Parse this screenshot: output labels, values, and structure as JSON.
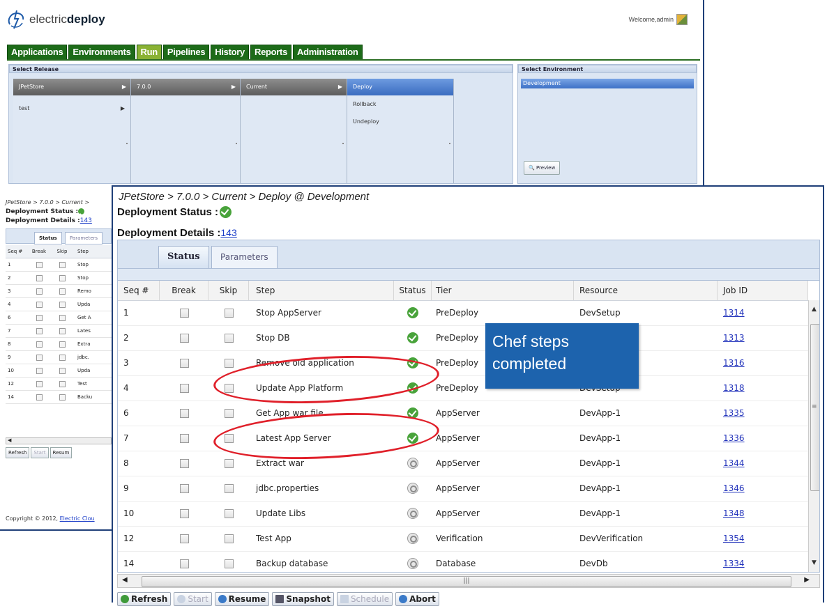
{
  "app": {
    "logo_plain": "electric",
    "logo_bold": "deploy",
    "welcome": "Welcome,admin"
  },
  "nav": {
    "tabs": [
      "Applications",
      "Environments",
      "Run",
      "Pipelines",
      "History",
      "Reports",
      "Administration"
    ],
    "active": "Run"
  },
  "release_panel": {
    "title": "Select Release",
    "applications": {
      "header": "JPetStore",
      "items": [
        "test"
      ]
    },
    "versions": {
      "header": "7.0.0"
    },
    "snapshots": {
      "header": "Current"
    },
    "processes": {
      "selected": "Deploy",
      "items": [
        "Rollback",
        "Undeploy"
      ]
    }
  },
  "env_panel": {
    "title": "Select Environment",
    "selected": "Development",
    "preview_label": "Preview"
  },
  "background_status": {
    "breadcrumb": "JPetStore > 7.0.0 > Current >",
    "status_label": "Deployment Status :",
    "details_label": "Deployment Details :",
    "details_link": "143",
    "tabs": [
      "Status",
      "Parameters"
    ],
    "columns": [
      "Seq #",
      "Break",
      "Skip",
      "Step"
    ],
    "rows": [
      {
        "seq": "1",
        "step": "Stop"
      },
      {
        "seq": "2",
        "step": "Stop"
      },
      {
        "seq": "3",
        "step": "Remo"
      },
      {
        "seq": "4",
        "step": "Upda"
      },
      {
        "seq": "6",
        "step": "Get A"
      },
      {
        "seq": "7",
        "step": "Lates"
      },
      {
        "seq": "8",
        "step": "Extra"
      },
      {
        "seq": "9",
        "step": "jdbc."
      },
      {
        "seq": "10",
        "step": "Upda"
      },
      {
        "seq": "12",
        "step": "Test"
      },
      {
        "seq": "14",
        "step": "Backu"
      }
    ],
    "toolbar": [
      "Refresh",
      "Start",
      "Resum"
    ],
    "copyright": "Copyright © 2012,",
    "copyright_link": "Electric Clou"
  },
  "deployment": {
    "breadcrumb": "JPetStore > 7.0.0 > Current > Deploy @ Development",
    "status_label": "Deployment Status :",
    "details_label": "Deployment Details :",
    "details_link": "143",
    "tabs": {
      "status": "Status",
      "parameters": "Parameters"
    },
    "columns": {
      "seq": "Seq #",
      "brk": "Break",
      "skip": "Skip",
      "step": "Step",
      "status": "Status",
      "tier": "Tier",
      "resource": "Resource",
      "job": "Job ID"
    },
    "rows": [
      {
        "seq": "1",
        "step": "Stop AppServer",
        "status": "completed",
        "tier": "PreDeploy",
        "resource": "DevSetup",
        "job": "1314"
      },
      {
        "seq": "2",
        "step": "Stop DB",
        "status": "completed",
        "tier": "PreDeploy",
        "resource": "",
        "job": "1313"
      },
      {
        "seq": "3",
        "step": "Remove old application",
        "status": "completed",
        "tier": "PreDeploy",
        "resource": "",
        "job": "1316"
      },
      {
        "seq": "4",
        "step": "Update App Platform",
        "status": "completed",
        "tier": "PreDeploy",
        "resource": "DevSetup",
        "job": "1318"
      },
      {
        "seq": "6",
        "step": "Get App war file",
        "status": "completed",
        "tier": "AppServer",
        "resource": "DevApp-1",
        "job": "1335"
      },
      {
        "seq": "7",
        "step": "Latest App Server",
        "status": "completed",
        "tier": "AppServer",
        "resource": "DevApp-1",
        "job": "1336"
      },
      {
        "seq": "8",
        "step": "Extract war",
        "status": "pending",
        "tier": "AppServer",
        "resource": "DevApp-1",
        "job": "1344"
      },
      {
        "seq": "9",
        "step": "jdbc.properties",
        "status": "pending",
        "tier": "AppServer",
        "resource": "DevApp-1",
        "job": "1346"
      },
      {
        "seq": "10",
        "step": "Update Libs",
        "status": "pending",
        "tier": "AppServer",
        "resource": "DevApp-1",
        "job": "1348"
      },
      {
        "seq": "12",
        "step": "Test App",
        "status": "pending",
        "tier": "Verification",
        "resource": "DevVerification",
        "job": "1354"
      },
      {
        "seq": "14",
        "step": "Backup database",
        "status": "pending",
        "tier": "Database",
        "resource": "DevDb",
        "job": "1334"
      }
    ],
    "toolbar": [
      "Refresh",
      "Start",
      "Resume",
      "Snapshot",
      "Schedule",
      "Abort"
    ],
    "toolbar_disabled": [
      "Start",
      "Schedule"
    ]
  },
  "annotation": {
    "callout_line1": "Chef steps",
    "callout_line2": "completed",
    "color": "#1d63ad",
    "ellipse_color": "#e0202a"
  }
}
